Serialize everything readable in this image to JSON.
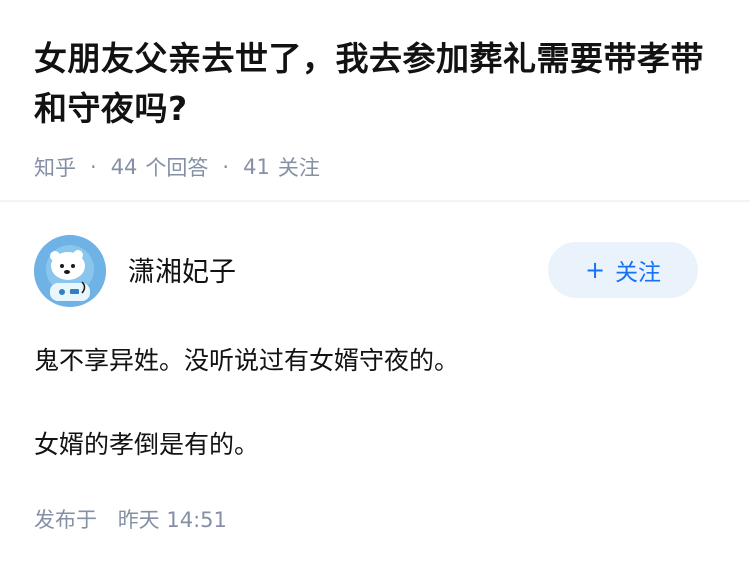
{
  "question": {
    "title": "女朋友父亲去世了，我去参加葬礼需要带孝带和守夜吗?",
    "source": "知乎",
    "answers_count": "44",
    "answers_label": "个回答",
    "followers_count": "41",
    "followers_label": "关注"
  },
  "answer": {
    "author": {
      "name": "潇湘妃子",
      "avatar_icon": "cartoon-polar-bear-astronaut-avatar"
    },
    "follow_button": {
      "icon": "plus",
      "label": "关注"
    },
    "paragraphs": [
      "鬼不享异姓。没听说过有女婿守夜的。",
      "女婿的孝倒是有的。"
    ],
    "published_label": "发布于",
    "published_time": "昨天 14:51"
  },
  "colors": {
    "meta_gray": "#8590a6",
    "brand_blue": "#1772f6",
    "button_bg": "#eaf2fc",
    "avatar_bg": "#6fb3e6"
  }
}
